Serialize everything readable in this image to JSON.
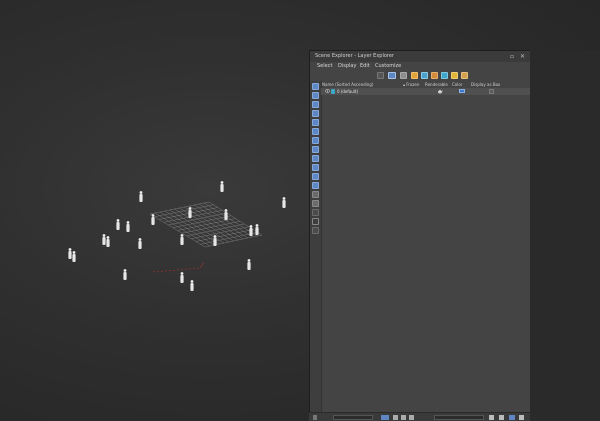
{
  "window": {
    "title": "Scene Explorer - Layer Explorer",
    "menu": [
      "Select",
      "Display",
      "Edit",
      "Customize"
    ]
  },
  "columns": {
    "name": "Name (Sorted Ascending)",
    "frozen": "▴ Frozen",
    "renderable": "Renderable",
    "color": "Color",
    "display_as_box": "Display as Box"
  },
  "layers": [
    {
      "label": "0 (default)",
      "color": "#3c7ac9"
    }
  ],
  "colors": {
    "accent": "#5d87c4",
    "panel": "#444444",
    "viewport": "#2f2f2f"
  },
  "icons": {
    "toolbar": [
      "filter-objects-icon",
      "filter-funnel-icon",
      "lock-icon",
      "highlight-icon",
      "layer-icon",
      "add-layer-icon",
      "layer-stack-icon",
      "lightbulb-icon",
      "settings-icon"
    ],
    "sidebar": [
      "display-all-icon",
      "geometry-icon",
      "shapes-icon",
      "lights-icon",
      "cameras-icon",
      "helpers-icon",
      "space-warps-icon",
      "groups-icon",
      "xrefs-icon",
      "bones-icon",
      "containers-icon",
      "frozen-icon",
      "hidden-icon",
      "invert-icon",
      "filter-icon",
      "layer-toggle-icon"
    ]
  }
}
